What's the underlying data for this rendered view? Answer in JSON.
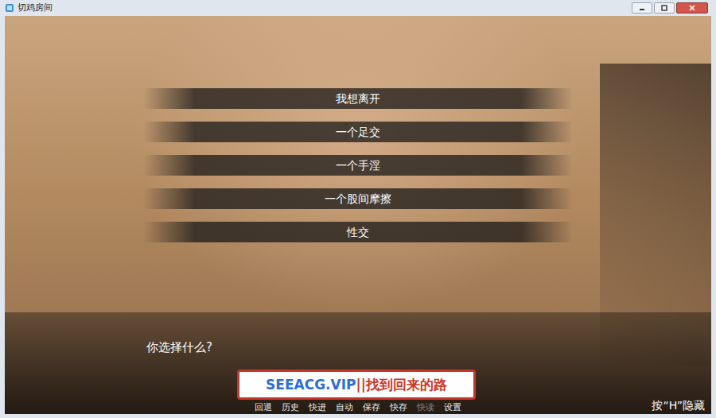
{
  "window": {
    "title": "切鸡房间"
  },
  "menu": {
    "choices": [
      {
        "label": "我想离开"
      },
      {
        "label": "一个足交"
      },
      {
        "label": "一个手淫"
      },
      {
        "label": "一个股间摩擦"
      },
      {
        "label": "性交"
      }
    ]
  },
  "dialogue": {
    "text": "你选择什么?"
  },
  "watermark": {
    "site": "SEEACG.VIP",
    "slogan": "||找到回来的路"
  },
  "quick_menu": [
    {
      "label": "回退",
      "disabled": false
    },
    {
      "label": "历史",
      "disabled": false
    },
    {
      "label": "快进",
      "disabled": false
    },
    {
      "label": "自动",
      "disabled": false
    },
    {
      "label": "保存",
      "disabled": false
    },
    {
      "label": "快存",
      "disabled": false
    },
    {
      "label": "快读",
      "disabled": true
    },
    {
      "label": "设置",
      "disabled": false
    }
  ],
  "hint": "按“H”隐藏"
}
